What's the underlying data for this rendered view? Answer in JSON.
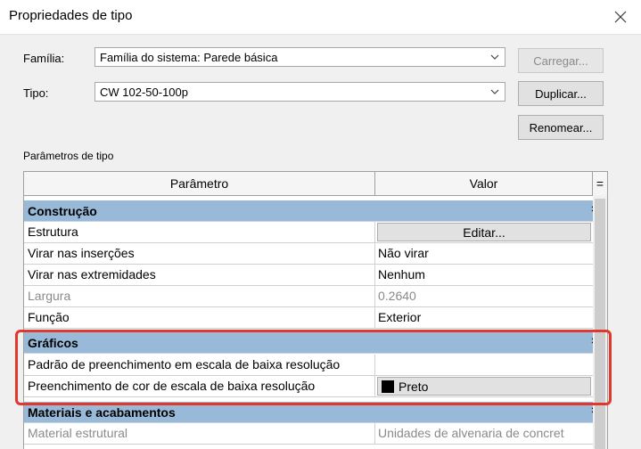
{
  "dialog": {
    "title": "Propriedades de tipo"
  },
  "family": {
    "label": "Família:",
    "value": "Família do sistema: Parede básica"
  },
  "type": {
    "label": "Tipo:",
    "value": "CW 102-50-100p"
  },
  "buttons": {
    "load": "Carregar...",
    "duplicate": "Duplicar...",
    "rename": "Renomear..."
  },
  "params": {
    "section_label": "Parâmetros de tipo",
    "header": {
      "parameter": "Parâmetro",
      "value": "Valor",
      "sort": "="
    },
    "groups": [
      {
        "name": "Construção",
        "rows": [
          {
            "param": "Estrutura",
            "value": "Editar..."
          },
          {
            "param": "Virar nas inserções",
            "value": "Não virar"
          },
          {
            "param": "Virar nas extremidades",
            "value": "Nenhum"
          },
          {
            "param": "Largura",
            "value": "0.2640"
          },
          {
            "param": "Função",
            "value": "Exterior"
          }
        ]
      },
      {
        "name": "Gráficos",
        "rows": [
          {
            "param": "Padrão de preenchimento em escala de baixa resolução",
            "value": ""
          },
          {
            "param": "Preenchimento de cor de escala de baixa resolução",
            "value": "Preto"
          }
        ]
      },
      {
        "name": "Materiais e acabamentos",
        "rows": [
          {
            "param": "Material estrutural",
            "value": "Unidades de alvenaria de concret"
          }
        ]
      }
    ]
  },
  "colors": {
    "group_header": "#98b9d8",
    "highlight": "#e2372b",
    "swatch": "#000000"
  }
}
